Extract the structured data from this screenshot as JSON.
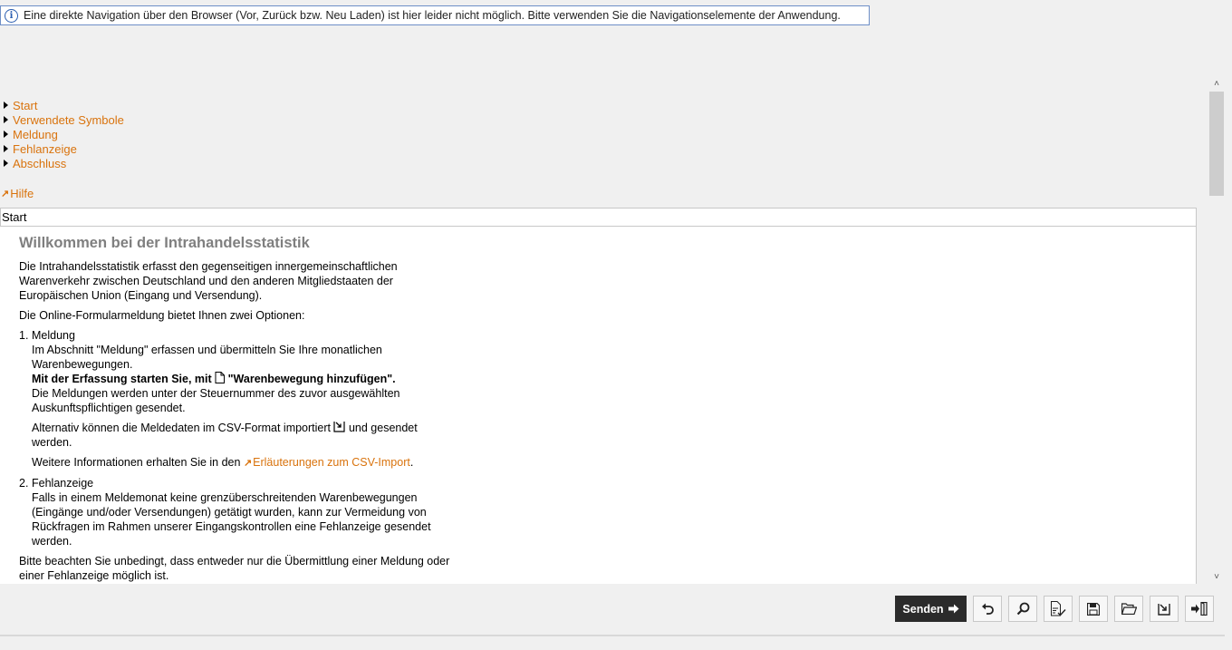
{
  "banner": {
    "text": "Eine direkte Navigation über den Browser (Vor, Zurück bzw. Neu Laden) ist hier leider nicht möglich. Bitte verwenden Sie die Navigationselemente der Anwendung."
  },
  "nav": {
    "items": [
      {
        "label": "Start"
      },
      {
        "label": "Verwendete Symbole"
      },
      {
        "label": "Meldung"
      },
      {
        "label": "Fehlanzeige"
      },
      {
        "label": "Abschluss"
      }
    ],
    "help_label": "Hilfe"
  },
  "section": {
    "title": "Start"
  },
  "content": {
    "heading": "Willkommen bei der Intrahandelsstatistik",
    "intro": "Die Intrahandelsstatistik erfasst den gegenseitigen innergemeinschaftlichen Warenverkehr zwischen Deutschland und den anderen Mitgliedstaaten der Europäischen Union (Eingang und Versendung).",
    "options_intro": "Die Online-Formularmeldung bietet Ihnen zwei Optionen:",
    "item1": {
      "number": "1.",
      "title": "Meldung",
      "text1": "Im Abschnitt \"Meldung\" erfassen und übermitteln Sie Ihre monatlichen Warenbewegungen.",
      "bold_prefix": "Mit der Erfassung starten Sie, mit ",
      "bold_suffix": " \"Warenbewegung hinzufügen\".",
      "text2": "Die Meldungen werden unter der Steuernummer des zuvor ausgewählten Auskunftspflichtigen gesendet.",
      "alt_prefix": "Alternativ können die Meldedaten im CSV-Format importiert ",
      "alt_suffix": " und gesendet werden.",
      "info_prefix": "Weitere Informationen erhalten Sie in den ",
      "info_link": "Erläuterungen zum CSV-Import",
      "info_suffix": "."
    },
    "item2": {
      "number": "2.",
      "title": "Fehlanzeige",
      "text": "Falls in einem Meldemonat keine grenzüberschreitenden Warenbewegungen (Eingänge und/oder Versendungen) getätigt wurden, kann zur Vermeidung von Rückfragen im Rahmen unserer Eingangskontrollen eine Fehlanzeige gesendet werden."
    },
    "note": "Bitte beachten Sie unbedingt, dass entweder nur die Übermittlung einer Meldung oder einer Fehlanzeige möglich ist."
  },
  "toolbar": {
    "send_label": "Senden",
    "icons": [
      "undo-icon",
      "search-icon",
      "check-document-icon",
      "save-icon",
      "open-folder-icon",
      "import-icon",
      "exit-icon"
    ]
  },
  "colors": {
    "link": "#d9730d",
    "heading": "#7f7f7f",
    "send_button": "#2b2b2b",
    "banner_border": "#6e8fc7"
  }
}
